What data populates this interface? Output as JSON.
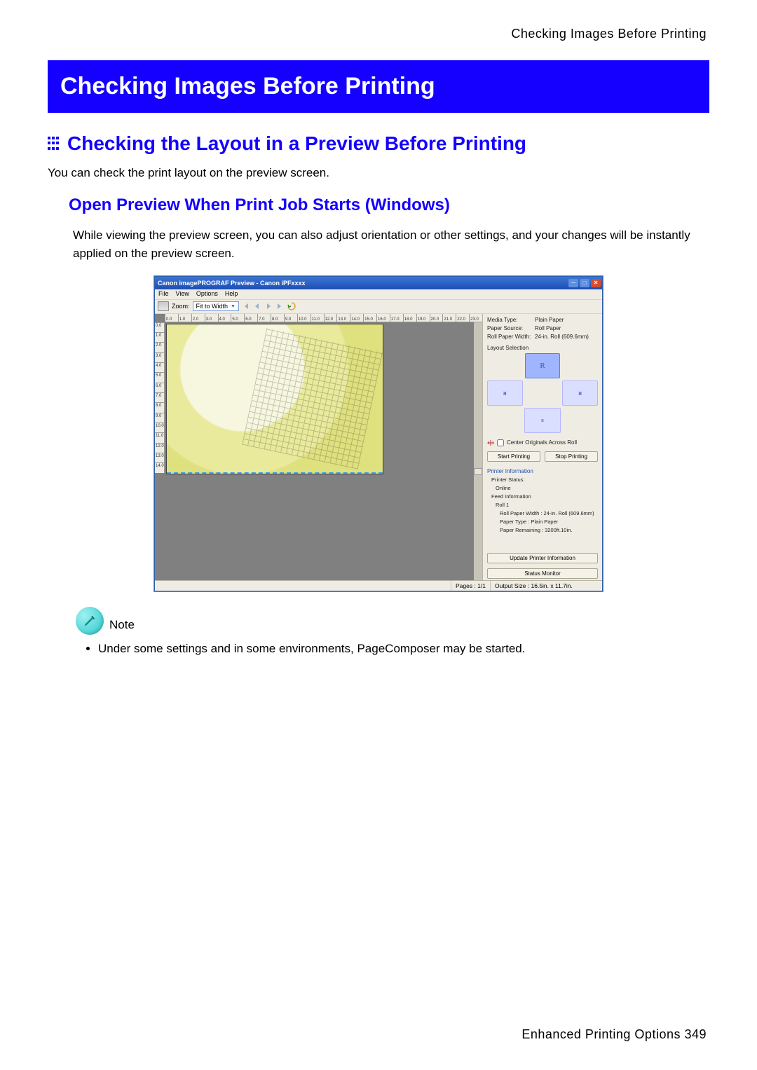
{
  "page": {
    "header_right": "Checking Images Before Printing",
    "band_title": "Checking Images Before Printing",
    "section_title": "Checking the Layout in a Preview Before Printing",
    "body1": "You can check the print layout on the preview screen.",
    "sub_heading": "Open Preview When Print Job Starts (Windows)",
    "sub_body": "While viewing the preview screen, you can also adjust orientation or other settings, and your changes will be instantly applied on the preview screen.",
    "note_label": "Note",
    "note_item1": "Under some settings and in some environments, PageComposer may be started.",
    "footer": "Enhanced Printing Options   349"
  },
  "app": {
    "title": "Canon imagePROGRAF Preview - Canon iPFxxxx",
    "menu": {
      "file": "File",
      "view": "View",
      "options": "Options",
      "help": "Help"
    },
    "toolbar": {
      "zoom_label": "Zoom:",
      "zoom_value": "Fit to Width"
    },
    "ruler_top": [
      "0.0",
      "1.0",
      "2.0",
      "3.0",
      "4.0",
      "5.0",
      "6.0",
      "7.0",
      "8.0",
      "9.0",
      "10.0",
      "11.0",
      "12.0",
      "13.0",
      "14.0",
      "15.0",
      "16.0",
      "17.0",
      "18.0",
      "19.0",
      "20.0",
      "21.0",
      "22.0",
      "23.0"
    ],
    "ruler_left": [
      "0.0",
      "1.0",
      "2.0",
      "3.0",
      "4.0",
      "5.0",
      "6.0",
      "7.0",
      "8.0",
      "9.0",
      "10.0",
      "11.0",
      "12.0",
      "13.0",
      "14.0"
    ],
    "side": {
      "media_type_k": "Media Type:",
      "media_type_v": "Plain Paper",
      "paper_source_k": "Paper Source:",
      "paper_source_v": "Roll Paper",
      "roll_width_k": "Roll Paper Width:",
      "roll_width_v": "24-in. Roll (609.6mm)",
      "layout_selection": "Layout Selection",
      "center_label": "Center Originals Across Roll",
      "start_printing": "Start Printing",
      "stop_printing": "Stop Printing",
      "printer_info": "Printer Information",
      "printer_status_k": "Printer Status:",
      "printer_status_v": "Online",
      "feed_info": "Feed Information",
      "roll1": "Roll 1",
      "feed_roll_width": "Roll Paper Width : 24-in. Roll (609.6mm)",
      "feed_paper_type": "Paper Type : Plain Paper",
      "feed_remaining": "Paper Remaining : 3200ft.10in.",
      "update_info": "Update Printer Information",
      "status_monitor": "Status Monitor"
    },
    "status": {
      "pages": "Pages : 1/1",
      "output": "Output Size : 16.5in. x 11.7in."
    }
  }
}
